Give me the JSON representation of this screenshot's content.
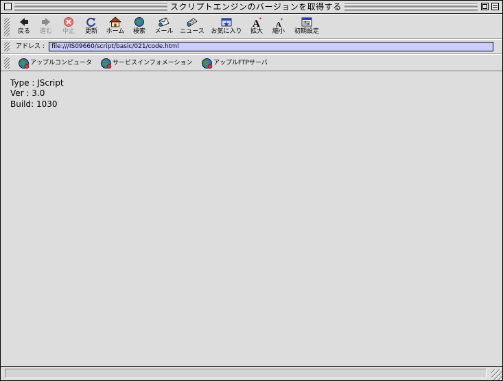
{
  "window": {
    "title": "スクリプトエンジンのバージョンを取得する"
  },
  "toolbar": {
    "back": {
      "label": "戻る",
      "icon": "back-arrow-icon"
    },
    "forward": {
      "label": "進む",
      "icon": "forward-arrow-icon"
    },
    "stop": {
      "label": "中止",
      "icon": "stop-icon"
    },
    "refresh": {
      "label": "更新",
      "icon": "refresh-icon"
    },
    "home": {
      "label": "ホーム",
      "icon": "home-icon"
    },
    "search": {
      "label": "検索",
      "icon": "globe-search-icon"
    },
    "mail": {
      "label": "メール",
      "icon": "mail-icon"
    },
    "news": {
      "label": "ニュース",
      "icon": "news-icon"
    },
    "favorites": {
      "label": "お気に入り",
      "icon": "favorites-icon"
    },
    "zoom_in": {
      "label": "拡大",
      "icon": "larger-text-icon"
    },
    "zoom_out": {
      "label": "縮小",
      "icon": "smaller-text-icon"
    },
    "preferences": {
      "label": "初期設定",
      "icon": "preferences-icon"
    }
  },
  "address": {
    "label": "アドレス :",
    "value": "file:///IS09660/script/basic/021/code.html"
  },
  "favorites_bar": [
    {
      "label": "アップルコンピュータ",
      "icon": "globe-link-icon"
    },
    {
      "label": "サービスインフォメーション",
      "icon": "globe-link-icon"
    },
    {
      "label": "アップルFTPサーバ",
      "icon": "globe-link-icon"
    }
  ],
  "content": {
    "lines": [
      "Type : JScript",
      "Ver : 3.0",
      "Build: 1030"
    ]
  },
  "colors": {
    "window_bg": "#dddddd",
    "address_field": "#ccccff",
    "stop_icon": "#d84a4a",
    "home_roof": "#b13a1f",
    "accent_blue": "#2244aa"
  }
}
